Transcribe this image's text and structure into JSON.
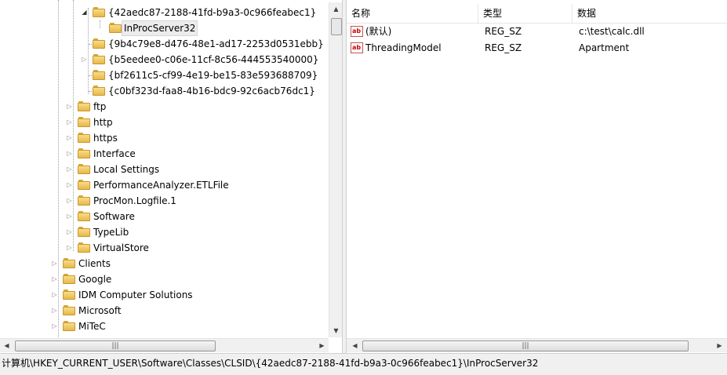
{
  "tree": {
    "rows": [
      {
        "label": "{42aedc87-2188-41fd-b9a3-0c966feabec1}",
        "expander": "open"
      },
      {
        "label": "InProcServer32",
        "expander": "none",
        "selected": true
      },
      {
        "label": "{9b4c79e8-d476-48e1-ad17-2253d0531ebb}",
        "expander": "none"
      },
      {
        "label": "{b5eedee0-c06e-11cf-8c56-444553540000}",
        "expander": "closed"
      },
      {
        "label": "{bf2611c5-cf99-4e19-be15-83e593688709}",
        "expander": "none"
      },
      {
        "label": "{c0bf323d-faa8-4b16-bdc9-92c6acb76dc1}",
        "expander": "none"
      },
      {
        "label": "ftp",
        "expander": "closed"
      },
      {
        "label": "http",
        "expander": "closed"
      },
      {
        "label": "https",
        "expander": "closed"
      },
      {
        "label": "Interface",
        "expander": "closed"
      },
      {
        "label": "Local Settings",
        "expander": "closed"
      },
      {
        "label": "PerformanceAnalyzer.ETLFile",
        "expander": "closed"
      },
      {
        "label": "ProcMon.Logfile.1",
        "expander": "closed"
      },
      {
        "label": "Software",
        "expander": "closed"
      },
      {
        "label": "TypeLib",
        "expander": "closed"
      },
      {
        "label": "VirtualStore",
        "expander": "closed"
      },
      {
        "label": "Clients",
        "expander": "closed"
      },
      {
        "label": "Google",
        "expander": "closed"
      },
      {
        "label": "IDM Computer Solutions",
        "expander": "closed"
      },
      {
        "label": "Microsoft",
        "expander": "closed"
      },
      {
        "label": "MiTeC",
        "expander": "closed"
      }
    ]
  },
  "list": {
    "columns": {
      "name": "名称",
      "type": "类型",
      "data": "数据"
    },
    "rows": [
      {
        "name": "(默认)",
        "type": "REG_SZ",
        "data": "c:\\test\\calc.dll",
        "icon": "string-value-icon"
      },
      {
        "name": "ThreadingModel",
        "type": "REG_SZ",
        "data": "Apartment",
        "icon": "string-value-icon"
      }
    ]
  },
  "scroll": {
    "thumb_grip": "|||"
  },
  "status": {
    "path": "计算机\\HKEY_CURRENT_USER\\Software\\Classes\\CLSID\\{42aedc87-2188-41fd-b9a3-0c966feabec1}\\InProcServer32"
  },
  "colors": {
    "folder": "#e8b84b",
    "selection": "#ececec",
    "statusbar": "#f0f0f0"
  }
}
